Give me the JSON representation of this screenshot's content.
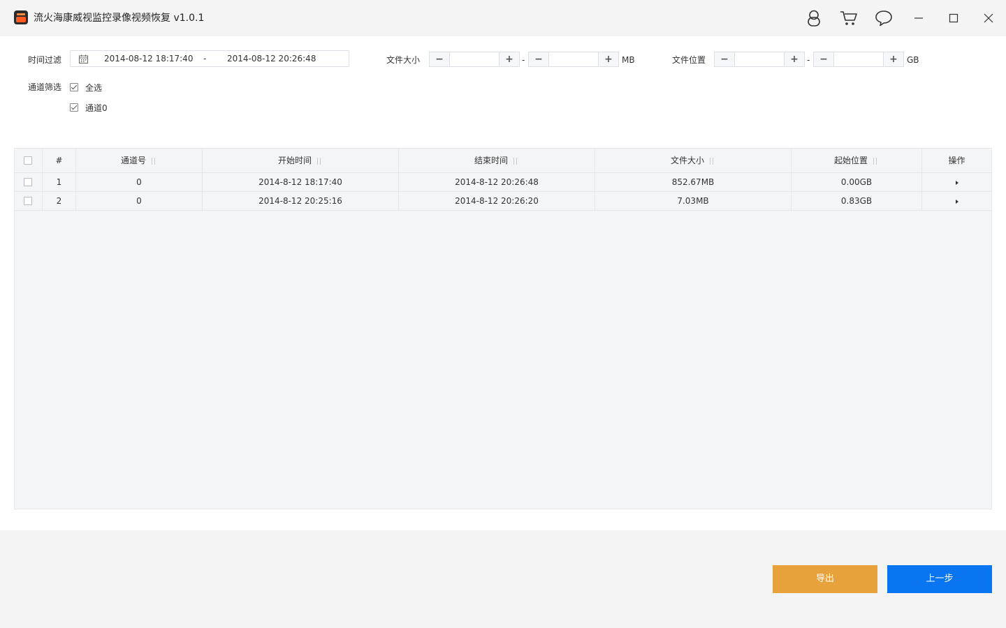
{
  "app": {
    "title": "流火海康威视监控录像视频恢复 v1.0.1"
  },
  "filters": {
    "time_label": "时间过滤",
    "start_time": "2014-08-12 18:17:40",
    "range_sep": "-",
    "end_time": "2014-08-12 20:26:48",
    "size_label": "文件大小",
    "size_unit": "MB",
    "position_label": "文件位置",
    "position_unit": "GB",
    "dash": "-",
    "minus": "−",
    "plus": "+",
    "channel_label": "通道筛选",
    "select_all": "全选",
    "channel0": "通道0"
  },
  "table": {
    "headers": {
      "index": "#",
      "channel": "通道号",
      "start": "开始时间",
      "end": "结束时间",
      "size": "文件大小",
      "offset": "起始位置",
      "action": "操作"
    },
    "rows": [
      {
        "index": "1",
        "channel": "0",
        "start": "2014-8-12 18:17:40",
        "end": "2014-8-12 20:26:48",
        "size": "852.67MB",
        "offset": "0.00GB"
      },
      {
        "index": "2",
        "channel": "0",
        "start": "2014-8-12 20:25:16",
        "end": "2014-8-12 20:26:20",
        "size": "7.03MB",
        "offset": "0.83GB"
      }
    ]
  },
  "footer": {
    "export_label": "导出",
    "back_label": "上一步"
  },
  "colors": {
    "export": "#e8a23c",
    "back": "#0a75f0"
  }
}
